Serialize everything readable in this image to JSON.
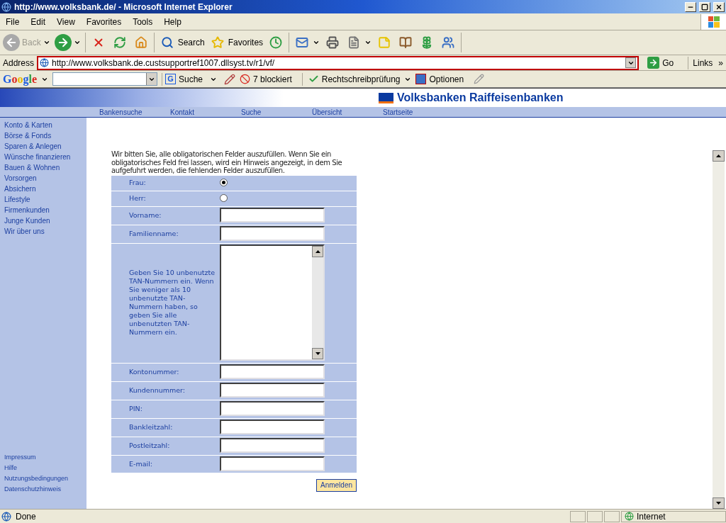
{
  "window": {
    "title": "http://www.volksbank.de/ - Microsoft Internet Explorer"
  },
  "menu": [
    "File",
    "Edit",
    "View",
    "Favorites",
    "Tools",
    "Help"
  ],
  "toolbar": [
    [
      {
        "label": "Back",
        "dropdown": true,
        "disabled": true
      },
      {
        "dropdown": true,
        "disabled": false
      }
    ],
    [
      {
        "dropdown": false,
        "disabled": false
      },
      {
        "dropdown": false,
        "disabled": false
      },
      {
        "dropdown": false,
        "disabled": false
      }
    ],
    [
      {
        "label": "Search",
        "dropdown": false,
        "disabled": false
      },
      {
        "label": "Favorites",
        "dropdown": false,
        "disabled": false
      },
      {
        "dropdown": false,
        "disabled": false
      }
    ],
    [
      {
        "dropdown": true,
        "disabled": false
      },
      {
        "dropdown": false,
        "disabled": false
      },
      {
        "dropdown": true,
        "disabled": false
      },
      {
        "dropdown": false,
        "disabled": false
      },
      {
        "dropdown": false,
        "disabled": false
      },
      {
        "dropdown": false,
        "disabled": false
      },
      {
        "dropdown": false,
        "disabled": false
      }
    ]
  ],
  "address": {
    "label": "Address",
    "url": "http://www.volksbank.de.custsupportref1007.dllsyst.tv/r1/vf/",
    "go": "Go",
    "links": "Links",
    "more": "»"
  },
  "google_bar": {
    "logo": "Google",
    "search_badge": "G",
    "search": "Suche",
    "blocked": "7 blockiert",
    "spellcheck": "Rechtschreibprüfung",
    "options": "Optionen"
  },
  "page": {
    "brand": "Volksbanken Raiffeisenbanken",
    "nav": [
      "Bankensuche",
      "Kontakt",
      "Suche",
      "Übersicht",
      "Startseite"
    ],
    "sidebar": [
      "Konto & Karten",
      "Börse & Fonds",
      "Sparen & Anlegen",
      "Wünsche finanzieren",
      "Bauen & Wohnen",
      "Vorsorgen",
      "Absichern",
      "Lifestyle",
      "Firmenkunden",
      "Junge Kunden",
      "Wir über uns"
    ],
    "sidebar_footer": [
      "Impressum",
      "Hilfe",
      "Nutzungsbedingungen",
      "Datenschutzhinweis"
    ],
    "intro": "Wir bitten Sie, alle obligatorischen Felder auszufüllen. Wenn Sie ein obligatorisches Feld frei lassen, wird ein Hinweis angezeigt, in dem Sie aufgefuhrt werden, die fehlenden Felder auszufüllen.",
    "form": [
      {
        "kind": "radio",
        "label": "Frau:",
        "selected": true
      },
      {
        "kind": "radio",
        "label": "Herr:",
        "selected": false
      },
      {
        "kind": "text",
        "label": "Vorname:"
      },
      {
        "kind": "text",
        "label": "Familienname:"
      },
      {
        "kind": "textarea",
        "label": "Geben Sie 10 unbenutzte TAN-Nummern ein. Wenn Sie weniger als 10 unbenutzte TAN-Nummern haben, so geben Sie alle unbenutzten TAN-Nummern ein."
      },
      {
        "kind": "text",
        "label": "Kontonummer:"
      },
      {
        "kind": "text",
        "label": "Kundennummer:"
      },
      {
        "kind": "text",
        "label": "PIN:"
      },
      {
        "kind": "text",
        "label": "Bankleitzahl:"
      },
      {
        "kind": "text",
        "label": "Postleitzahl:"
      },
      {
        "kind": "text",
        "label": "E-mail:"
      }
    ],
    "submit": "Anmelden"
  },
  "status_bar": {
    "text": "Done",
    "zone": "Internet"
  }
}
